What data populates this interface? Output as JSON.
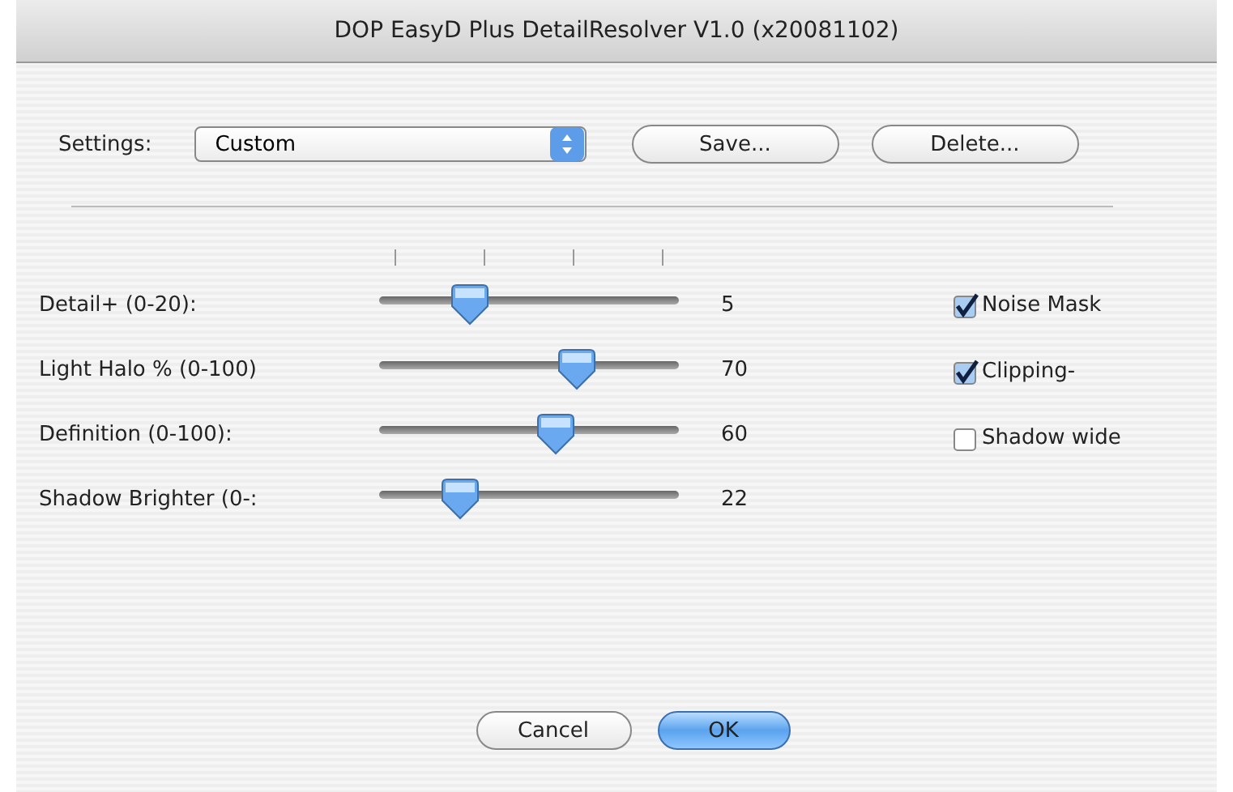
{
  "window": {
    "title": "DOP EasyD Plus DetailResolver V1.0 (x20081102)"
  },
  "settings": {
    "label": "Settings:",
    "value": "Custom",
    "buttons": [
      "Save...",
      "Delete..."
    ]
  },
  "sliders": [
    {
      "label": "Detail+ (0-20):",
      "level": 0.3,
      "reading": "5",
      "ticks": true
    },
    {
      "label": "Light Halo % (0-100)",
      "level": 0.66,
      "reading": "70"
    },
    {
      "label": "Definition (0-100):",
      "level": 0.59,
      "reading": "60"
    },
    {
      "label": "Shadow Brighter (0-:",
      "level": 0.27,
      "reading": "22"
    }
  ],
  "checkboxes": [
    {
      "label": "Noise Mask",
      "checked": true
    },
    {
      "label": "Clipping-",
      "checked": true
    },
    {
      "label": "Shadow wide",
      "checked": false
    }
  ],
  "buttons": [
    {
      "label": "Cancel",
      "kind": "normal"
    },
    {
      "label": "OK",
      "kind": "default"
    }
  ]
}
